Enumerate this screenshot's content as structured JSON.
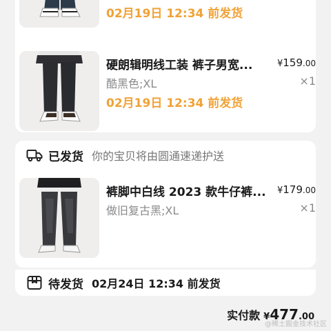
{
  "products": [
    {
      "title": "",
      "spec": "",
      "price_yen": "",
      "price_int": "",
      "price_dec": "",
      "qty": "",
      "ship_time": "02月19日 12:34 前发货"
    },
    {
      "title": "硬朗辑明线工装 裤子男宽...",
      "spec": "酷黑色;XL",
      "price_yen": "¥",
      "price_int": "159",
      "price_dec": ".00",
      "qty": "×1",
      "ship_time": "02月19日 12:34 前发货"
    },
    {
      "title": "裤脚中白线 2023 款牛仔裤...",
      "spec": "做旧复古黑;XL",
      "price_yen": "¥",
      "price_int": "179",
      "price_dec": ".00",
      "qty": "×1",
      "ship_time": ""
    }
  ],
  "shipped": {
    "label": "已发货",
    "desc": "你的宝贝将由圆通速递护送",
    "icon": "truck-icon"
  },
  "pending": {
    "label": "待发货",
    "time": "02月24日 12:34 前发货",
    "icon": "box-icon"
  },
  "total": {
    "label": "实付款",
    "yen": "¥",
    "int": "477",
    "dec": ".00"
  },
  "watermark": "@稀土掘金技术社区",
  "colors": {
    "ship_time": "#f0a236",
    "background": "#f2f2f2",
    "card": "#ffffff"
  }
}
